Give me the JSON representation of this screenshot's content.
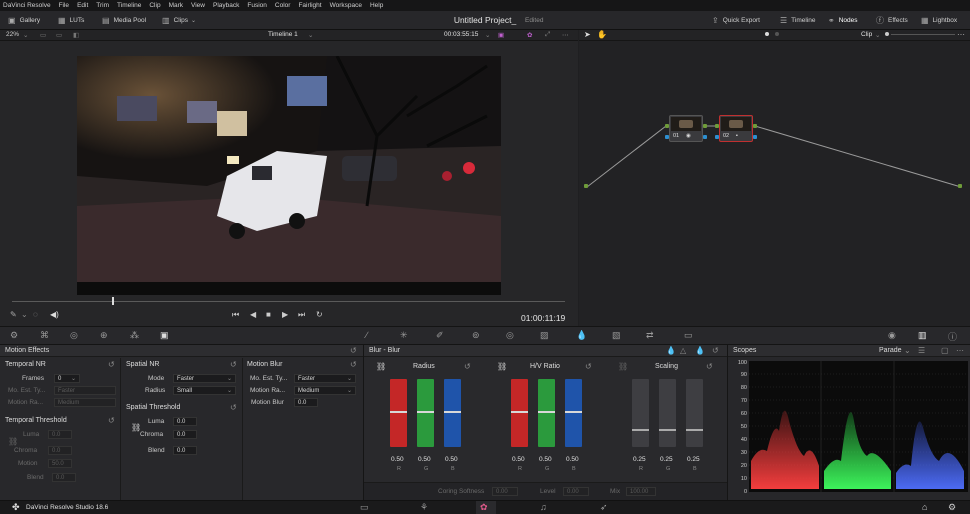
{
  "menu": [
    "DaVinci Resolve",
    "File",
    "Edit",
    "Trim",
    "Timeline",
    "Clip",
    "Mark",
    "View",
    "Playback",
    "Fusion",
    "Color",
    "Fairlight",
    "Workspace",
    "Help"
  ],
  "pagebar": {
    "gallery": "Gallery",
    "luts": "LUTs",
    "media_pool": "Media Pool",
    "clips": "Clips",
    "project_title": "Untitled Project_",
    "project_status": "Edited",
    "quick_export": "Quick Export",
    "timeline": "Timeline",
    "nodes": "Nodes",
    "effects": "Effects",
    "lightbox": "Lightbox"
  },
  "viewer": {
    "zoom": "22%",
    "timeline_name": "Timeline 1",
    "timecode_top": "00:03:55:15",
    "timecode": "01:00:11:19",
    "playhead_fraction": 0.18
  },
  "node_editor": {
    "mode": "Clip",
    "node1_label": "01",
    "node2_label": "02"
  },
  "motion_effects": {
    "title": "Motion Effects",
    "temporal_nr": {
      "title": "Temporal NR",
      "frames_label": "Frames",
      "frames_value": "0",
      "mo_est_label": "Mo. Est. Ty...",
      "mo_est_value": "Faster",
      "motion_range_label": "Motion Ra...",
      "motion_range_value": "Medium"
    },
    "temporal_threshold": {
      "title": "Temporal Threshold",
      "luma_label": "Luma",
      "luma_value": "0.0",
      "chroma_label": "Chroma",
      "chroma_value": "0.0",
      "motion_label": "Motion",
      "motion_value": "50.0",
      "blend_label": "Blend",
      "blend_value": "0.0"
    },
    "spatial_nr": {
      "title": "Spatial NR",
      "mode_label": "Mode",
      "mode_value": "Faster",
      "radius_label": "Radius",
      "radius_value": "Small"
    },
    "spatial_threshold": {
      "title": "Spatial Threshold",
      "luma_label": "Luma",
      "luma_value": "0.0",
      "chroma_label": "Chroma",
      "chroma_value": "0.0",
      "blend_label": "Blend",
      "blend_value": "0.0"
    },
    "motion_blur": {
      "title": "Motion Blur",
      "mo_est_label": "Mo. Est. Ty...",
      "mo_est_value": "Faster",
      "motion_range_label": "Motion Ra...",
      "motion_range_value": "Medium",
      "motion_blur_label": "Motion Blur",
      "motion_blur_value": "0.0"
    }
  },
  "blur": {
    "title": "Blur - Blur",
    "radius": {
      "title": "Radius",
      "r": "0.50",
      "g": "0.50",
      "b": "0.50"
    },
    "hv_ratio": {
      "title": "H/V Ratio",
      "r": "0.50",
      "g": "0.50",
      "b": "0.50"
    },
    "scaling": {
      "title": "Scaling",
      "r": "0.25",
      "g": "0.25",
      "b": "0.25"
    },
    "channel_r": "R",
    "channel_g": "G",
    "channel_b": "B",
    "coring_label": "Coring Softness",
    "coring_value": "0.00",
    "level_label": "Level",
    "level_value": "0.00",
    "mix_label": "Mix",
    "mix_value": "100.00"
  },
  "scopes": {
    "title": "Scopes",
    "mode": "Parade",
    "ticks": [
      "100",
      "90",
      "80",
      "70",
      "60",
      "50",
      "40",
      "30",
      "20",
      "10",
      "0"
    ]
  },
  "bottombar": {
    "app_name": "DaVinci Resolve Studio 18.6"
  }
}
